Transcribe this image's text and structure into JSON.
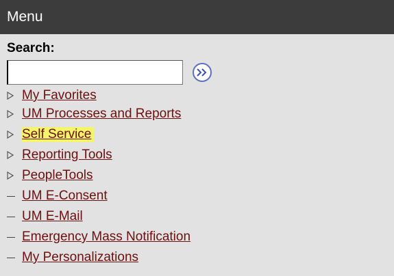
{
  "header": {
    "title": "Menu"
  },
  "search": {
    "label": "Search:",
    "value": "",
    "placeholder": ""
  },
  "go_button": {
    "icon": "double-chevron-right-icon",
    "glyph": "»"
  },
  "menu_items": [
    {
      "label": "My Favorites",
      "type": "folder"
    },
    {
      "label": "UM Processes and Reports",
      "type": "folder"
    },
    {
      "label": "Self Service",
      "type": "folder",
      "highlighted": true,
      "highlight_color": "#f4f56a"
    },
    {
      "label": "Reporting Tools",
      "type": "folder"
    },
    {
      "label": "PeopleTools",
      "type": "folder"
    },
    {
      "label": "UM E-Consent",
      "type": "link"
    },
    {
      "label": "UM E-Mail",
      "type": "link"
    },
    {
      "label": "Emergency Mass Notification",
      "type": "link"
    },
    {
      "label": "My Personalizations",
      "type": "link"
    }
  ],
  "colors": {
    "header_bg": "#3c3c3c",
    "panel_bg": "#e2e2e2",
    "link": "#6b0f0f",
    "highlight": "#f4f56a"
  }
}
